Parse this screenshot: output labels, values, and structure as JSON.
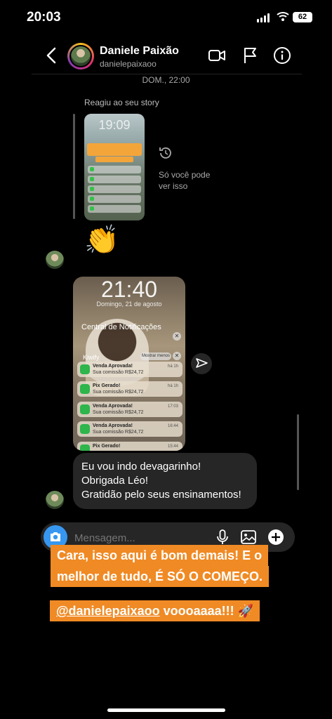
{
  "status_bar": {
    "time": "20:03",
    "battery": "62"
  },
  "header": {
    "name": "Daniele Paixão",
    "username": "danielepaixaoo"
  },
  "thread": {
    "date_label": "DOM., 22:00",
    "story_reply_label": "Reagiu ao seu story",
    "story_clock": "19:09",
    "story_note": [
      "Só você pode",
      "ver isso"
    ],
    "reaction_emoji": "👏",
    "screenshot": {
      "time": "21:40",
      "date": "Domingo, 21 de agosto",
      "center_title": "Central de Notificações",
      "app_name": "Kiwify",
      "show_less": "Mostrar menos",
      "notifications": [
        {
          "title": "Venda Aprovada!",
          "sub": "Sua comissão R$24,72",
          "time": "há 1h"
        },
        {
          "title": "Pix Gerado!",
          "sub": "Sua comissão R$24,72",
          "time": "há 1h"
        },
        {
          "title": "Venda Aprovada!",
          "sub": "Sua comissão R$24,72",
          "time": "17:03"
        },
        {
          "title": "Venda Aprovada!",
          "sub": "Sua comissão R$24,72",
          "time": "16:44"
        },
        {
          "title": "Pix Gerado!",
          "sub": "",
          "time": "15:44"
        }
      ]
    },
    "message_lines": [
      "Eu vou indo devagarinho!",
      "Obrigada Léo!",
      "Gratidão pelo seus ensinamentos!"
    ]
  },
  "composer": {
    "placeholder": "Mensagem..."
  },
  "overlay": {
    "line1": "Cara, isso aqui é bom demais! E o",
    "line2": "melhor de tudo, É SÓ O COMEÇO.",
    "mention": "@danielepaixaoo",
    "line3_rest": " voooaaaa!!! 🚀"
  },
  "colors": {
    "accent": "#3797f0",
    "overlay": "#f08a24",
    "bubble": "#262626"
  }
}
